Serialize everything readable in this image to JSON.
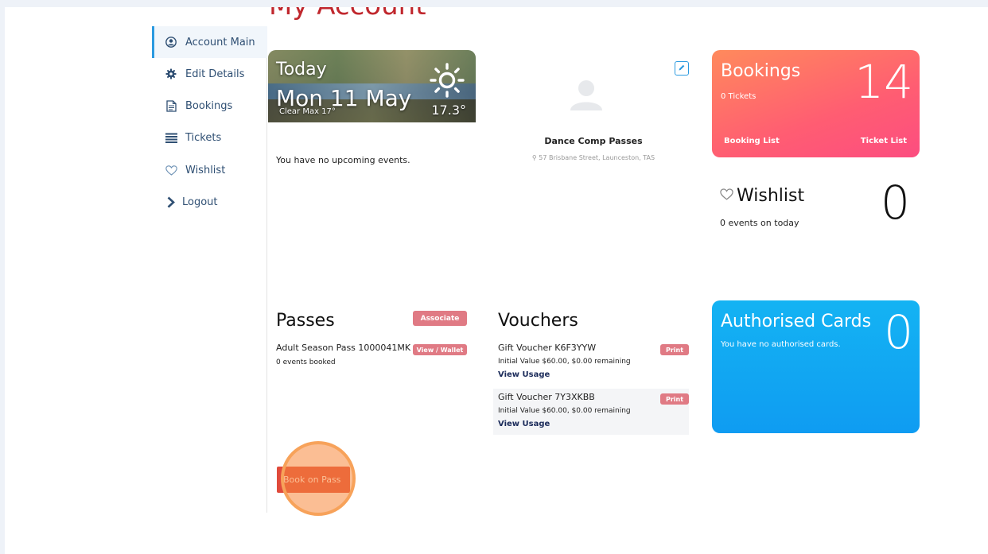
{
  "page": {
    "title": "My Account"
  },
  "sidebar": {
    "items": [
      {
        "label": "Account Main",
        "icon": "user-circle-icon",
        "active": true
      },
      {
        "label": "Edit Details",
        "icon": "gear-icon"
      },
      {
        "label": "Bookings",
        "icon": "document-icon"
      },
      {
        "label": "Tickets",
        "icon": "list-icon"
      },
      {
        "label": "Wishlist",
        "icon": "heart-icon"
      },
      {
        "label": "Logout",
        "icon": "chevron-right-icon"
      }
    ]
  },
  "today": {
    "label": "Today",
    "date": "Mon 11 May",
    "weather": "Clear Max 17°",
    "temp": "17.3°",
    "empty_text": "You have no upcoming events."
  },
  "profile": {
    "name": "Dance Comp Passes",
    "address": "57 Brisbane Street, Launceston, TAS"
  },
  "bookings": {
    "title": "Bookings",
    "count": "14",
    "subtitle": "0 Tickets",
    "link_bookings": "Booking List",
    "link_tickets": "Ticket List"
  },
  "wishlist": {
    "title": "Wishlist",
    "count": "0",
    "subtitle": "0 events on today"
  },
  "passes": {
    "title": "Passes",
    "associate_label": "Associate",
    "items": [
      {
        "name": "Adult Season Pass 1000041MK",
        "sub": "0 events booked",
        "action": "View / Wallet"
      }
    ],
    "book_button": "Book on Pass"
  },
  "vouchers": {
    "title": "Vouchers",
    "items": [
      {
        "name": "Gift Voucher K6F3YYW",
        "sub": "Initial Value $60.00, $0.00 remaining",
        "link": "View Usage",
        "action": "Print"
      },
      {
        "name": "Gift Voucher 7Y3XKBB",
        "sub": "Initial Value $60.00, $0.00 remaining",
        "link": "View Usage",
        "action": "Print"
      }
    ]
  },
  "authorised": {
    "title": "Authorised Cards",
    "count": "0",
    "subtitle": "You have no authorised cards."
  },
  "colors": {
    "title_red": "#c0272d",
    "accent_blue": "#2b9ae0",
    "bookings_start": "#ff8a5c",
    "bookings_end": "#fc4d80",
    "authorised_blue": "#0f9cf2",
    "pill_pink": "#e07a84",
    "book_button": "#e04a3b",
    "cursor_orange": "#f7a25a"
  }
}
